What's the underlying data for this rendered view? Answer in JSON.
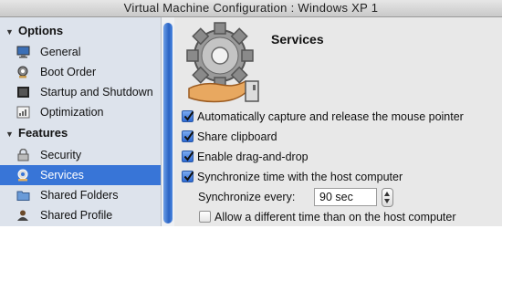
{
  "window": {
    "title": "Virtual Machine Configuration : Windows XP 1"
  },
  "sidebar": {
    "sections": [
      {
        "label": "Options",
        "items": [
          {
            "label": "General",
            "icon": "monitor-icon"
          },
          {
            "label": "Boot Order",
            "icon": "boot-gear-icon"
          },
          {
            "label": "Startup and Shutdown",
            "icon": "startup-icon"
          },
          {
            "label": "Optimization",
            "icon": "optimization-icon"
          }
        ]
      },
      {
        "label": "Features",
        "items": [
          {
            "label": "Security",
            "icon": "security-icon"
          },
          {
            "label": "Services",
            "icon": "services-icon",
            "selected": true
          },
          {
            "label": "Shared Folders",
            "icon": "shared-folders-icon"
          },
          {
            "label": "Shared Profile",
            "icon": "shared-profile-icon"
          }
        ]
      }
    ]
  },
  "main": {
    "heading": "Services",
    "icon": "services-gear-hand-icon",
    "options": [
      {
        "label": "Automatically capture and release the mouse pointer",
        "checked": true
      },
      {
        "label": "Share clipboard",
        "checked": true
      },
      {
        "label": "Enable drag-and-drop",
        "checked": true
      },
      {
        "label": "Synchronize time with the host computer",
        "checked": true
      }
    ],
    "sync": {
      "label": "Synchronize every:",
      "value": "90 sec"
    },
    "allow_different": {
      "label": "Allow a different time than on the host computer",
      "checked": false
    }
  },
  "colors": {
    "selection": "#3875d7",
    "sidebar_bg": "#dde3ec",
    "window_bg": "#e8e8e8"
  }
}
